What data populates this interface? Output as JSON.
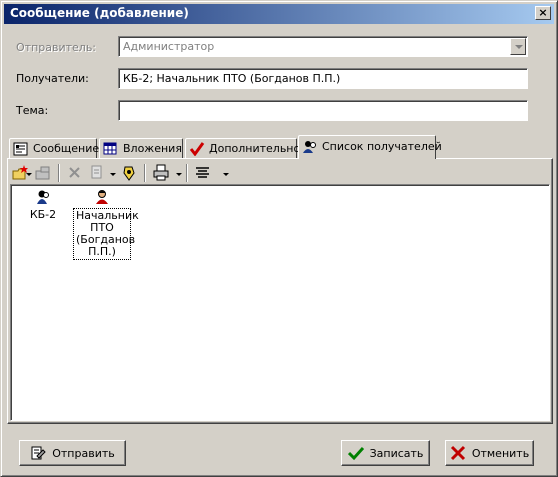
{
  "window": {
    "title": "Сообщение (добавление)",
    "close_glyph": "×"
  },
  "form": {
    "sender_label": "Отправитель:",
    "sender_value": "Администратор",
    "recipients_label": "Получатели:",
    "recipients_value": "КБ-2; Начальник ПТО (Богданов П.П.)",
    "subject_label": "Тема:",
    "subject_value": ""
  },
  "tabs": [
    {
      "label": "Сообщение",
      "icon": "message-icon"
    },
    {
      "label": "Вложения",
      "icon": "attachments-icon"
    },
    {
      "label": "Дополнительно",
      "icon": "checkmark-icon"
    },
    {
      "label": "Список получателей",
      "icon": "recipients-icon",
      "active": true
    }
  ],
  "toolbar": {
    "icons": [
      "add-recipient-icon",
      "add-group-icon",
      "delete-icon",
      "copy-icon",
      "properties-icon",
      "print-icon",
      "view-mode-icon"
    ]
  },
  "recipients": [
    {
      "label": "КБ-2",
      "icon": "group-icon"
    },
    {
      "label": "Начальник ПТО (Богданов П.П.)",
      "icon": "person-icon",
      "label_lines": [
        "Начальник",
        "ПТО",
        "(Богданов",
        "П.П.)"
      ]
    }
  ],
  "buttons": {
    "send": "Отправить",
    "save": "Записать",
    "cancel": "Отменить"
  },
  "colors": {
    "titlebar_start": "#0a246a",
    "titlebar_end": "#a6caf0",
    "face": "#d4d0c8"
  }
}
